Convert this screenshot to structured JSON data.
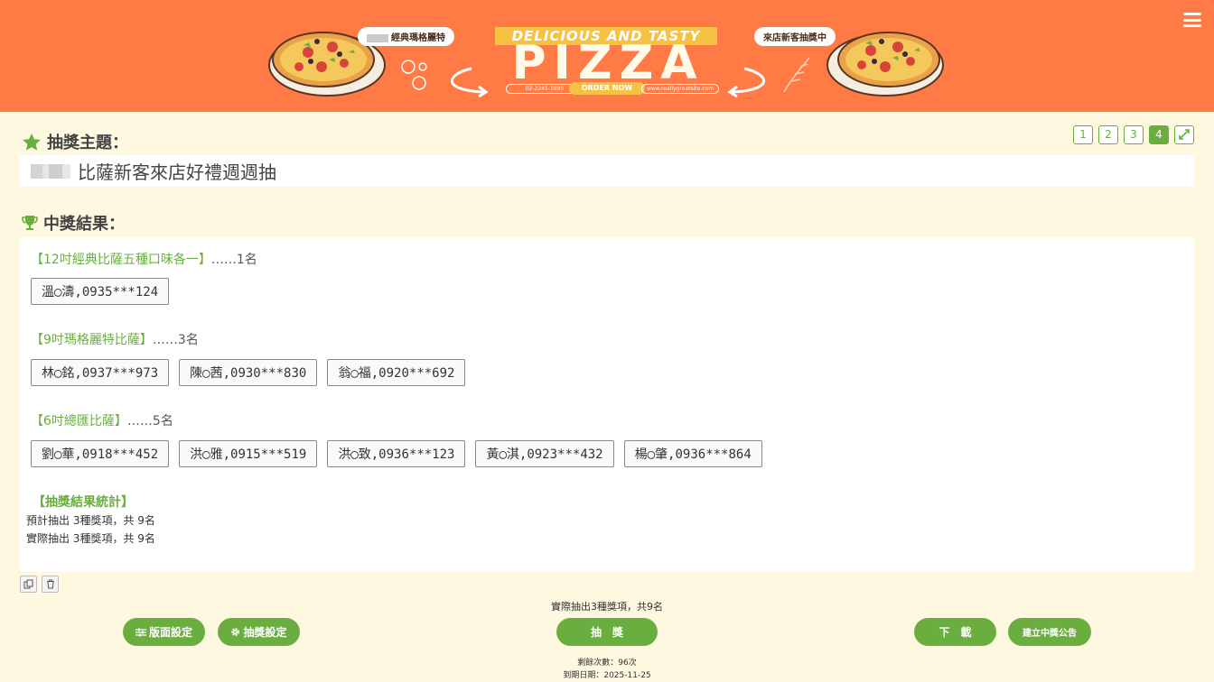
{
  "banner": {
    "left_pill": "經典瑪格麗特",
    "tagline": "DELICIOUS AND TASTY",
    "headline": "PIZZA",
    "right_pill": "來店新客抽獎中",
    "phone": "02-2245-1880",
    "order": "ORDER NOW",
    "website": "www.reallygreatsite.com"
  },
  "menu_icon": "hamburger-icon",
  "topic": {
    "label": "抽獎主題：",
    "value": "比薩新客來店好禮週週抽"
  },
  "pages": [
    "1",
    "2",
    "3",
    "4"
  ],
  "active_page": "4",
  "results": {
    "label": "中獎結果：",
    "prizes": [
      {
        "name": "【12吋經典比薩五種口味各一】",
        "count": "……1名",
        "winners": [
          "溫◯濤,0935***124"
        ]
      },
      {
        "name": "【9吋瑪格麗特比薩】",
        "count": "……3名",
        "winners": [
          "林◯銘,0937***973",
          "陳◯茜,0930***830",
          "翁◯福,0920***692"
        ]
      },
      {
        "name": "【6吋總匯比薩】",
        "count": "……5名",
        "winners": [
          "劉◯華,0918***452",
          "洪◯雅,0915***519",
          "洪◯致,0936***123",
          "黃◯淇,0923***432",
          "楊◯肇,0936***864"
        ]
      }
    ],
    "stats_title": "【抽獎結果統計】",
    "stats_expected": "預計抽出 3種獎項，共 9名",
    "stats_actual": "實際抽出 3種獎項，共 9名"
  },
  "summary": "實際抽出3種獎項，共9名",
  "buttons": {
    "layout": "版面設定",
    "draw_settings": "抽獎設定",
    "draw": "抽　獎",
    "download": "下　載",
    "announce": "建立中獎公告"
  },
  "footer": {
    "remaining": "剩餘次數：96次",
    "expiry": "到期日期：2025-11-25"
  },
  "colors": {
    "banner": "#ff7a45",
    "accent": "#6aae3f",
    "background": "#fdf8df"
  }
}
